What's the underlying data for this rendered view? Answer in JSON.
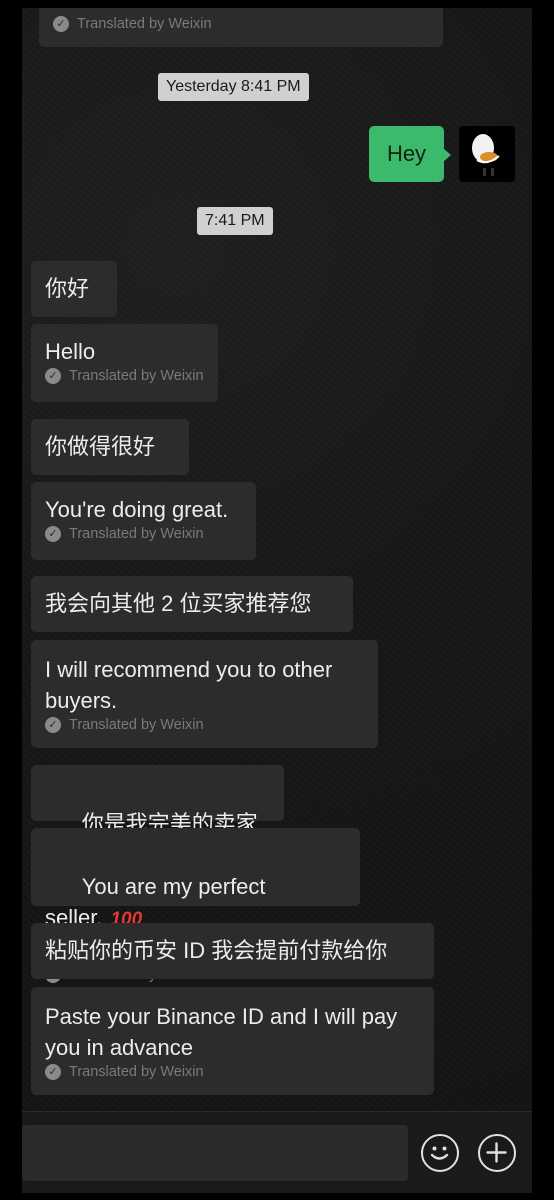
{
  "translated_label": "Translated by Weixin",
  "timestamps": [
    "Yesterday 8:41 PM",
    "7:41 PM"
  ],
  "sent_message": "Hey",
  "messages": [
    {
      "original": "你好",
      "translation": "Hello"
    },
    {
      "original": "你做得很好",
      "translation": "You're doing great."
    },
    {
      "original": "我会向其他 2 位买家推荐您",
      "translation": "I will recommend you to other\nbuyers."
    },
    {
      "original": "你是我完美的卖家",
      "translation": "You are my perfect seller."
    },
    {
      "original": "粘贴你的币安 ID 我会提前付款给你",
      "translation": "Paste your Binance ID and I will pay\nyou in advance"
    }
  ],
  "emoji": "hundred-points-emoji",
  "icons": {
    "emoji_button": "smiley-icon",
    "more_button": "plus-icon",
    "check": "check-circle-icon"
  },
  "colors": {
    "sent_bubble": "#3cba6b",
    "received_bubble": "#2c2c2c",
    "timestamp_bg": "#d0d0d0"
  }
}
